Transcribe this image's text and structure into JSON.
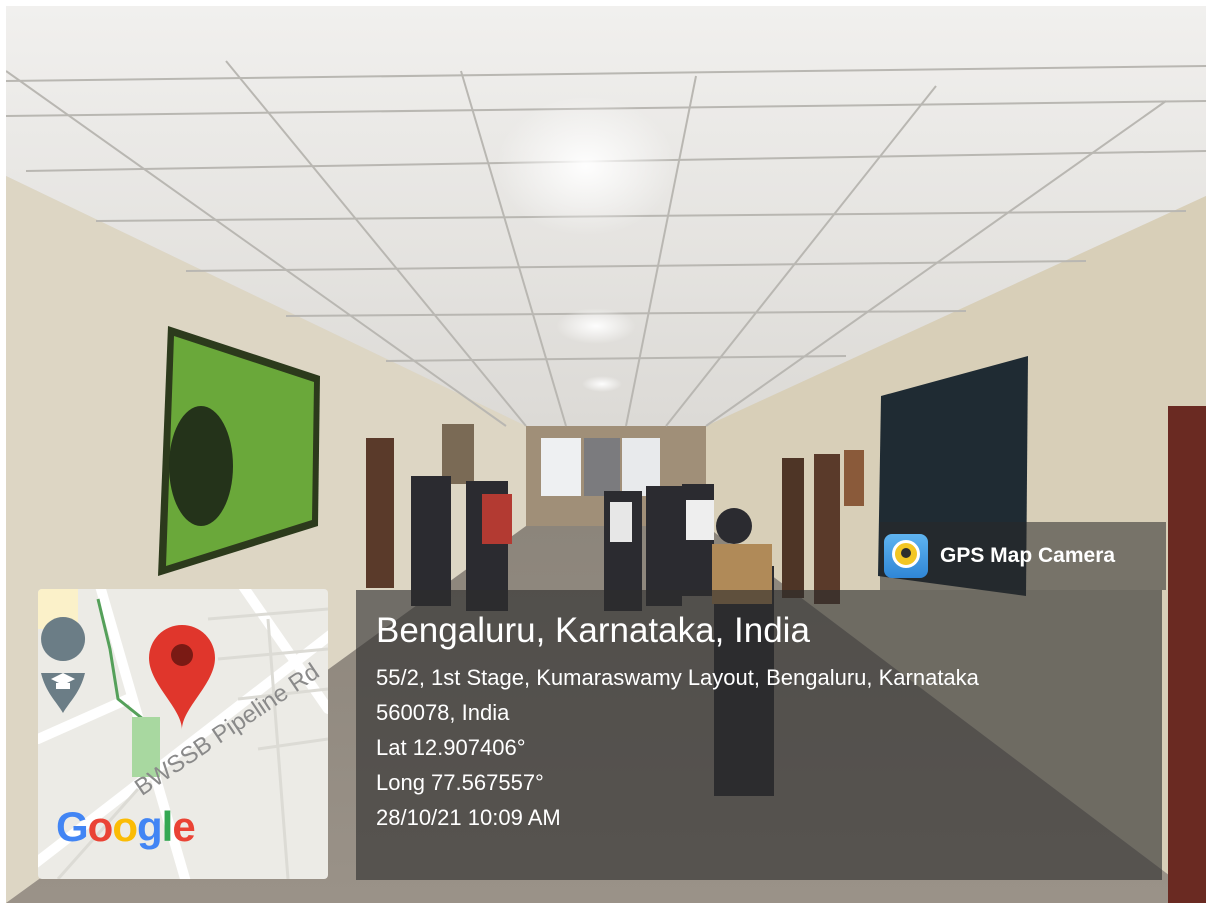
{
  "overlay": {
    "app_name": "GPS Map Camera",
    "app_icon": "gps-map-camera-icon",
    "place": "Bengaluru, Karnataka, India",
    "address_line1": "55/2, 1st Stage, Kumaraswamy Layout, Bengaluru, Karnataka",
    "address_line2": "560078, India",
    "latitude": "Lat 12.907406°",
    "longitude": "Long 77.567557°",
    "datetime": "28/10/21 10:09 AM"
  },
  "map": {
    "road_label": "BWSSB Pipeline Rd",
    "logo": "Google",
    "pin_icon": "location-pin-icon",
    "poi_icon": "education-icon"
  },
  "colors": {
    "pin": "#e0362c",
    "poi": "#6b7d86",
    "panel": "rgba(45,45,45,0.62)"
  }
}
